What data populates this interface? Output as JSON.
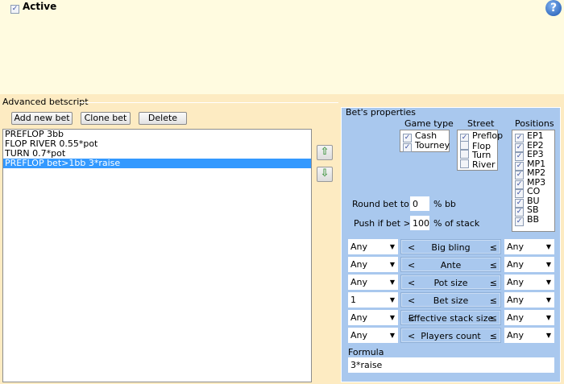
{
  "header": {
    "active_label": "Active",
    "active_checked": true,
    "help_icon": "help-icon"
  },
  "advanced": {
    "title": "Advanced betscript",
    "buttons": {
      "add": "Add new bet",
      "clone": "Clone bet",
      "delete": "Delete"
    },
    "bets": [
      "PREFLOP 3bb",
      "FLOP RIVER 0.55*pot",
      "TURN 0.7*pot",
      "PREFLOP bet>1bb 3*raise"
    ],
    "selected_index": 3,
    "move_up_icon": "arrow-up-icon",
    "move_down_icon": "arrow-down-icon"
  },
  "properties": {
    "title": "Bet's properties",
    "game_type": {
      "label": "Game type",
      "items": [
        {
          "label": "Cash",
          "checked": true
        },
        {
          "label": "Tourney",
          "checked": true
        }
      ]
    },
    "street": {
      "label": "Street",
      "items": [
        {
          "label": "Preflop",
          "checked": true
        },
        {
          "label": "Flop",
          "checked": false
        },
        {
          "label": "Turn",
          "checked": false
        },
        {
          "label": "River",
          "checked": false
        }
      ]
    },
    "positions": {
      "label": "Positions",
      "items": [
        {
          "label": "EP1",
          "checked": true
        },
        {
          "label": "EP2",
          "checked": true
        },
        {
          "label": "EP3",
          "checked": true
        },
        {
          "label": "MP1",
          "checked": true
        },
        {
          "label": "MP2",
          "checked": true
        },
        {
          "label": "MP3",
          "checked": true
        },
        {
          "label": "CO",
          "checked": true
        },
        {
          "label": "BU",
          "checked": true
        },
        {
          "label": "SB",
          "checked": true
        },
        {
          "label": "BB",
          "checked": true
        }
      ]
    },
    "round": {
      "label": "Round bet to",
      "value": "0",
      "unit": "% bb"
    },
    "push": {
      "label": "Push if bet >",
      "value": "100",
      "unit": "% of stack"
    },
    "conditions": [
      {
        "min": "Any",
        "lt": "<",
        "name": "Big bling",
        "le": "≤",
        "max": "Any"
      },
      {
        "min": "Any",
        "lt": "<",
        "name": "Ante",
        "le": "≤",
        "max": "Any"
      },
      {
        "min": "Any",
        "lt": "<",
        "name": "Pot size",
        "le": "≤",
        "max": "Any"
      },
      {
        "min": "1",
        "lt": "<",
        "name": "Bet size",
        "le": "≤",
        "max": "Any"
      },
      {
        "min": "Any",
        "lt": "<",
        "name": "Effective stack size",
        "le": "≤",
        "max": "Any"
      },
      {
        "min": "Any",
        "lt": "<",
        "name": "Players count",
        "le": "≤",
        "max": "Any"
      }
    ],
    "formula": {
      "label": "Formula",
      "value": "3*raise"
    }
  }
}
